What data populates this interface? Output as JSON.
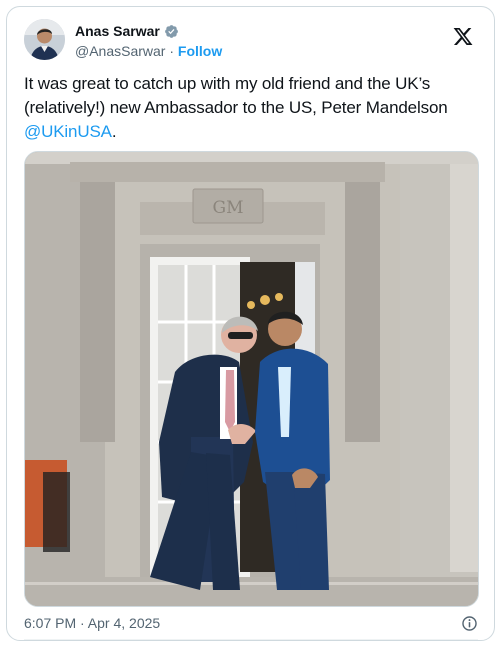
{
  "author": {
    "display_name": "Anas Sarwar",
    "handle": "@AnasSarwar",
    "separator": " · ",
    "follow_label": "Follow",
    "avatar_icon": "avatar-icon",
    "verified_icon": "verified-badge-icon"
  },
  "platform": {
    "logo_icon": "x-logo-icon"
  },
  "tweet": {
    "text_main": "It was great to catch up with my old friend and the UK’s (relatively!) new Ambassador to the US, Peter Mandelson ",
    "mention": "@UKinUSA",
    "text_end": "."
  },
  "meta": {
    "timestamp": "6:07 PM · Apr 4, 2025",
    "info_icon": "info-icon"
  },
  "colors": {
    "link": "#1d9bf0",
    "primary_text": "#0f1419",
    "secondary_text": "#536471",
    "border": "#cfd9de",
    "verified": "#829aab"
  }
}
